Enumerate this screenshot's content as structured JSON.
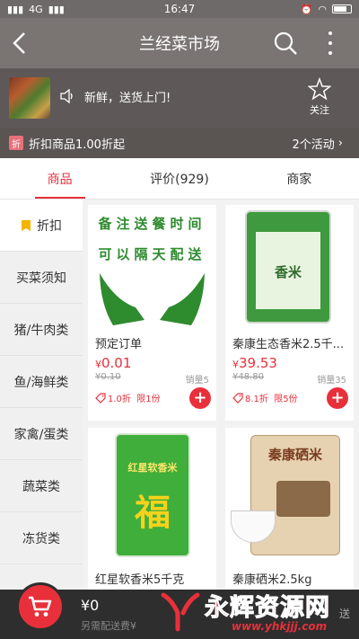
{
  "status_bar": {
    "carrier": "4G",
    "time": "16:47"
  },
  "header": {
    "title": "兰经菜市场"
  },
  "shop": {
    "notice": "新鲜，送货上门!",
    "favorite_label": "关注"
  },
  "promo": {
    "badge": "折",
    "text": "折扣商品1.00折起",
    "activities": "2个活动",
    "chevron": "›"
  },
  "tabs": [
    {
      "label": "商品",
      "active": true
    },
    {
      "label": "评价(929)",
      "active": false
    },
    {
      "label": "商家",
      "active": false
    }
  ],
  "categories": [
    {
      "label": "折扣",
      "active": true,
      "icon": "tag-icon"
    },
    {
      "label": "买菜须知"
    },
    {
      "label": "猪/牛肉类"
    },
    {
      "label": "鱼/海鲜类"
    },
    {
      "label": "家禽/蛋类"
    },
    {
      "label": "蔬菜类"
    },
    {
      "label": "冻货类"
    }
  ],
  "products": [
    {
      "name": "预定订单",
      "price": "0.01",
      "currency": "¥",
      "original_price": "¥0.10",
      "sales": "销量5",
      "discount": "1.0折",
      "limit": "限1份",
      "image_text_1": "备注送餐时间",
      "image_text_2": "可以隔天配送"
    },
    {
      "name": "秦康生态香米2.5千...",
      "price": "39.53",
      "currency": "¥",
      "original_price": "¥48.80",
      "sales": "销量35",
      "discount": "8.1折",
      "limit": "限5份",
      "image_text_1": "香米"
    },
    {
      "name": "红星软香米5千克",
      "image_text_1": "红星软香米",
      "image_text_2": "福"
    },
    {
      "name": "秦康硒米2.5kg",
      "image_text_1": "秦康硒米"
    }
  ],
  "cart": {
    "total": "¥0",
    "note": "另需配送费¥",
    "right_text": "送"
  },
  "watermark": {
    "text": "永辉资源网",
    "url": "www.yhkjjj.com"
  },
  "colors": {
    "accent": "#e8303b",
    "header": "#7a7473",
    "green": "#2e8b2e"
  }
}
